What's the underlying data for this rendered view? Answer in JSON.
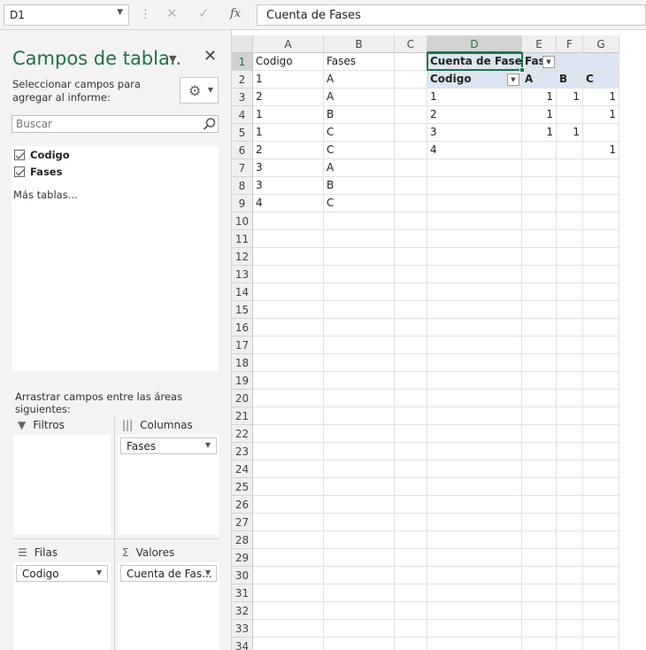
{
  "formula_bar": {
    "name_box": "D1",
    "formula": "Cuenta de Fases",
    "fx_label": "fx",
    "cancel_glyph": "✕",
    "enter_glyph": "✓"
  },
  "pivot_pane": {
    "title": "Campos de tabla..",
    "instruction": "Seleccionar campos para agregar al informe:",
    "search_placeholder": "Buscar",
    "fields": [
      {
        "label": "Codigo",
        "checked": true
      },
      {
        "label": "Fases",
        "checked": true
      }
    ],
    "more_tables": "Más tablas...",
    "drag_instruction": "Arrastrar campos entre las áreas siguientes:",
    "areas": {
      "filters": {
        "label": "Filtros",
        "items": []
      },
      "columns": {
        "label": "Columnas",
        "items": [
          "Fases"
        ]
      },
      "rows": {
        "label": "Filas",
        "items": [
          "Codigo"
        ]
      },
      "values": {
        "label": "Valores",
        "items": [
          "Cuenta de Fas..."
        ]
      }
    }
  },
  "sheet": {
    "columns": [
      "A",
      "B",
      "C",
      "D",
      "E",
      "F",
      "G"
    ],
    "rows": [
      "1",
      "2",
      "3",
      "4",
      "5",
      "6",
      "7",
      "8",
      "9",
      "10",
      "11",
      "12",
      "13",
      "14",
      "15",
      "16",
      "17",
      "18",
      "19",
      "20",
      "21",
      "22",
      "23",
      "24",
      "25",
      "26",
      "27",
      "28",
      "29",
      "30",
      "31",
      "32",
      "33",
      "34"
    ],
    "active_cell": "D1",
    "source_table": {
      "headers": [
        "Codigo",
        "Fases"
      ],
      "rows": [
        [
          "1",
          "A"
        ],
        [
          "2",
          "A"
        ],
        [
          "1",
          "B"
        ],
        [
          "1",
          "C"
        ],
        [
          "2",
          "C"
        ],
        [
          "3",
          "A"
        ],
        [
          "3",
          "B"
        ],
        [
          "4",
          "C"
        ]
      ]
    },
    "pivot": {
      "value_header": "Cuenta de Fases",
      "column_field": "Fas",
      "row_field": "Codigo",
      "column_labels": [
        "A",
        "B",
        "C"
      ],
      "row_labels": [
        "1",
        "2",
        "3",
        "4"
      ],
      "values": [
        [
          "1",
          "1",
          "1"
        ],
        [
          "1",
          "",
          "1"
        ],
        [
          "1",
          "1",
          ""
        ],
        [
          "",
          "",
          "1"
        ]
      ]
    }
  },
  "colors": {
    "accent": "#217346",
    "pivot_header_bg": "#dce6f1"
  }
}
